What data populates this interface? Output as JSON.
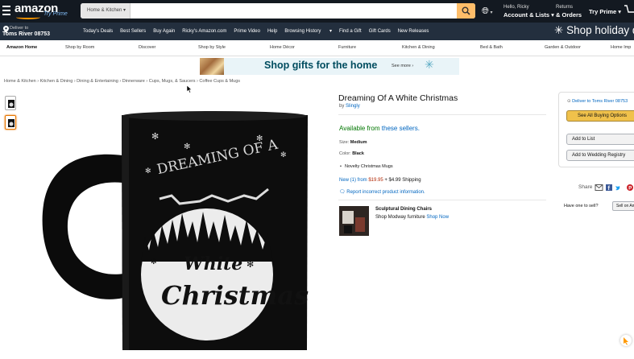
{
  "header": {
    "logo": "amazon",
    "logo_sub": "Try Prime",
    "search_category": "Home & Kitchen",
    "search_value": "",
    "account_greeting": "Hello, Ricky",
    "account_label": "Account & Lists",
    "returns_label": "Returns",
    "orders_label": "& Orders",
    "prime_label": "Try Prime"
  },
  "subnav": {
    "deliver_line1": "Deliver to",
    "deliver_line2": "Toms River 08753",
    "links": [
      "Today's Deals",
      "Best Sellers",
      "Buy Again",
      "Ricky's Amazon.com",
      "Prime Video",
      "Help",
      "Browsing History",
      "Find a Gift",
      "Gift Cards",
      "New Releases"
    ],
    "promo": "Shop holiday de"
  },
  "category_nav": [
    "Amazon Home",
    "Shop by Room",
    "Discover",
    "Shop by Style",
    "Home Décor",
    "Furniture",
    "Kitchen & Dining",
    "Bed & Bath",
    "Garden & Outdoor",
    "Home Imp"
  ],
  "banner": {
    "text": "Shop gifts for the home",
    "more": "See more ›"
  },
  "breadcrumb": "Home & Kitchen › Kitchen & Dining › Dining & Entertaining › Dinnerware › Cups, Mugs, & Saucers › Coffee Cups & Mugs",
  "product": {
    "title": "Dreaming Of A White Christmas",
    "by_prefix": "by",
    "brand": "Slingly",
    "availability_prefix": "Available from",
    "availability_link": "these sellers.",
    "size_label": "Size:",
    "size_value": "Medium",
    "color_label": "Color:",
    "color_value": "Black",
    "bullet": "Novelty Christmas Mugs",
    "new_from_link": "New (1) from",
    "new_from_price": "$19.95",
    "shipping": "+ $4.99 Shipping",
    "report": "Report incorrect product information.",
    "mug_text_1": "DREAMING OF A",
    "mug_text_2": "White",
    "mug_text_3": "Christmas"
  },
  "ad": {
    "title": "Sculptural Dining Chairs",
    "sub": "Shop Modway furniture",
    "cta": "Shop Now"
  },
  "buybox": {
    "deliver": "Deliver to Toms River 08753",
    "see_all": "See All Buying Options",
    "add_list": "Add to List",
    "add_registry": "Add to Wedding Registry"
  },
  "share": {
    "label": "Share",
    "have_one": "Have one to sell?",
    "sell": "Sell on Amazon"
  },
  "colors": {
    "nav_dark": "#131921",
    "nav_sub": "#232f3e",
    "accent": "#febd69",
    "link": "#0066c0",
    "price": "#b12704",
    "available": "#007600"
  }
}
